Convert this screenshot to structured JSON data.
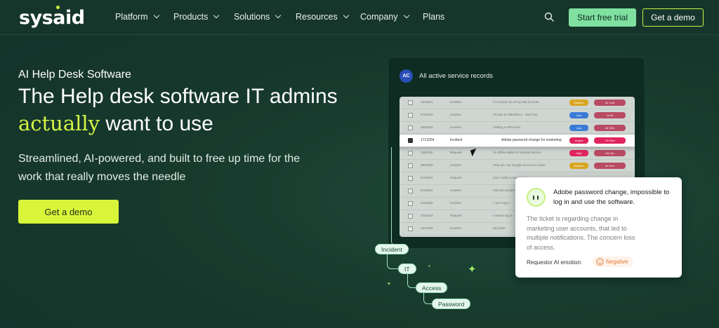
{
  "nav": {
    "logo": "sysaid",
    "items": [
      {
        "label": "Platform",
        "dropdown": true
      },
      {
        "label": "Products",
        "dropdown": true
      },
      {
        "label": "Solutions",
        "dropdown": true
      },
      {
        "label": "Resources",
        "dropdown": true
      },
      {
        "label": "Company",
        "dropdown": true
      },
      {
        "label": "Plans",
        "dropdown": false
      }
    ],
    "trial_label": "Start free trial",
    "demo_label": "Get a demo"
  },
  "hero": {
    "eyebrow": "AI Help Desk Software",
    "headline_part1": "The Help desk software IT admins ",
    "headline_accent": "actually",
    "headline_part2": " want to use",
    "subtext": "Streamlined, AI-powered, and built to free up time for the work that really moves the needle",
    "cta_label": "Get a demo"
  },
  "panel": {
    "avatar_initials": "AC",
    "title": "All active service records",
    "rows": [
      {
        "id": "1513641",
        "type": "Incident",
        "title": "I'm locked out of my 365 account",
        "priority": "Medium",
        "sla": "2h 14m"
      },
      {
        "id": "6731974",
        "type": "Incident",
        "title": "Access to Salesforce - New hire",
        "priority": "Low",
        "sla": "1d 3h"
      },
      {
        "id": "3646315",
        "type": "Incident",
        "title": "Getting a VPN error",
        "priority": "Low",
        "sla": "3h 40m"
      },
      {
        "id": "1713254",
        "type": "Incident",
        "title": "Adobe password change for marketing",
        "priority": "Urgent",
        "sla": "-2h 03m",
        "highlighted": true
      },
      {
        "id": "1502150",
        "type": "Request",
        "title": "An offline tablet its security service",
        "priority": "High",
        "sla": "5d 14h"
      },
      {
        "id": "5807650",
        "type": "Incident",
        "title": "Help me, my Google account is locke",
        "priority": "Medium",
        "sla": "4h 11m"
      },
      {
        "id": "6794501",
        "type": "Request",
        "title": "Can I order a new laptop",
        "priority": "",
        "sla": ""
      },
      {
        "id": "6794501",
        "type": "Incident",
        "title": "Internal comms",
        "priority": "",
        "sla": ""
      },
      {
        "id": "3154382",
        "type": "Incident",
        "title": "I can't log in",
        "priority": "",
        "sla": ""
      },
      {
        "id": "3754162",
        "type": "Request",
        "title": "I need a log in",
        "priority": "",
        "sla": ""
      },
      {
        "id": "1547920",
        "type": "Incident",
        "title": "My ticket",
        "priority": "",
        "sla": ""
      }
    ]
  },
  "ai_card": {
    "title": "Adobe password change, impossible to log in and use the software.",
    "description": "The ticket is regarding change in marketing user accounts, that led to multiple notifications. The concern loss of access.",
    "emotion_label": "Requestor AI emotion:",
    "emotion_value": "Negative"
  },
  "tags": [
    "Incident",
    "IT",
    "Access",
    "Password"
  ],
  "colors": {
    "accent_lime": "#d9f53a",
    "accent_green": "#7fe0a0",
    "background": "#173a2d",
    "urgent": "#e0245e",
    "medium": "#d9a520",
    "low": "#3a7bd5",
    "negative": "#e27b3a"
  }
}
